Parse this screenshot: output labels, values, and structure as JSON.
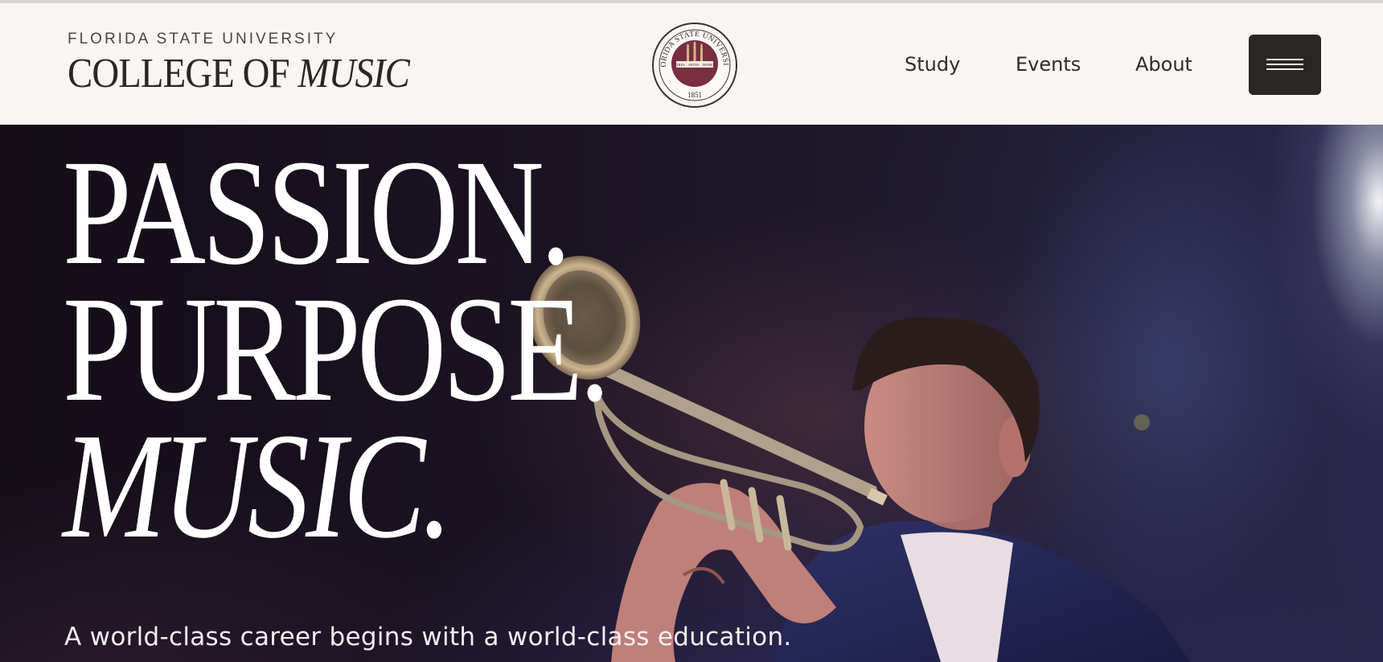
{
  "header": {
    "university": "FLORIDA STATE UNIVERSITY",
    "college_prefix": "COLLEGE OF",
    "college_name": "MUSIC",
    "seal": {
      "ring_text": "FLORIDA STATE UNIVERSITY",
      "year": "1851",
      "banner_words": [
        "VIRES",
        "ARTES",
        "MORES"
      ]
    }
  },
  "nav": {
    "items": [
      "Study",
      "Events",
      "About"
    ]
  },
  "hero": {
    "headline": [
      "PASSION.",
      "PURPOSE.",
      "MUSIC."
    ],
    "intro": "A world-class career begins with a world-class education. We are dedicated to preparing musicians for"
  },
  "colors": {
    "garnet": "#782f40",
    "gold": "#ceb888",
    "dark": "#2b2626",
    "header_bg": "#f8f5f2"
  }
}
